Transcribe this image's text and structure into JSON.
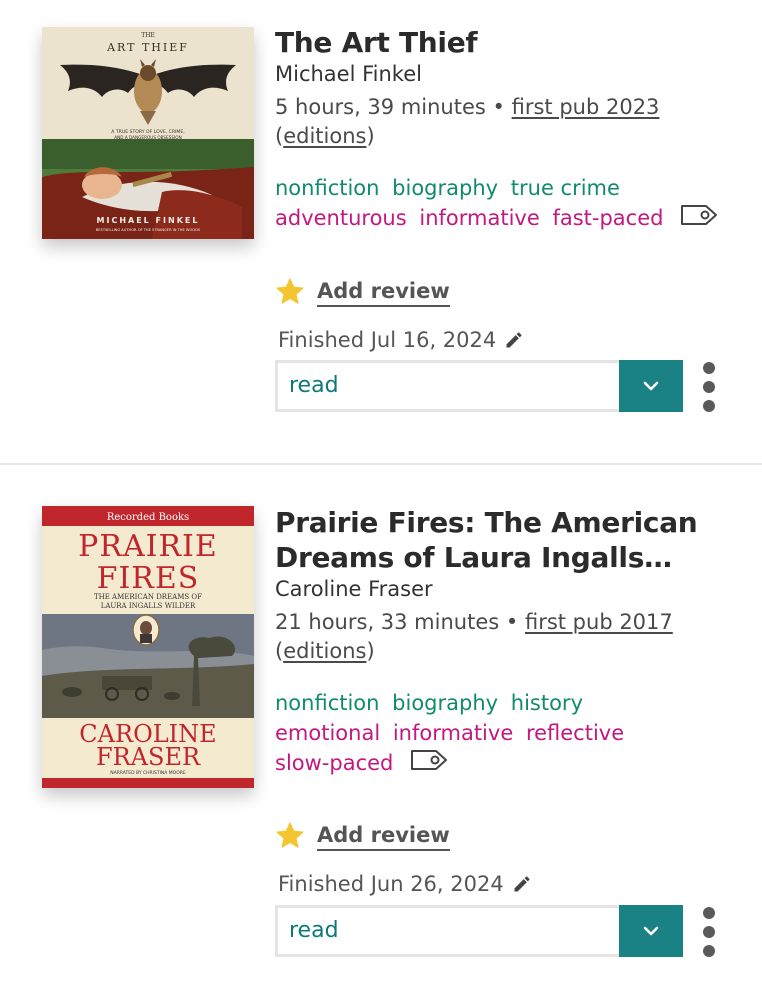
{
  "books": [
    {
      "title": "The Art Thief",
      "author": "Michael Finkel",
      "duration": "5 hours, 39 minutes",
      "separator": "•",
      "first_pub": "first pub 2023",
      "editions": "editions",
      "genre_tags": [
        "nonfiction",
        "biography",
        "true crime"
      ],
      "mood_tags": [
        "adventurous",
        "informative",
        "fast-paced"
      ],
      "add_review": "Add review",
      "finished": "Finished Jul 16, 2024",
      "status": "read",
      "cover": {
        "top_text": "THE",
        "title": "ART THIEF",
        "subtitle_1": "A TRUE STORY OF LOVE, CRIME,",
        "subtitle_2": "AND A DANGEROUS OBSESSION",
        "author": "MICHAEL FINKEL",
        "tagline": "BESTSELLING AUTHOR OF THE STRANGER IN THE WOODS"
      }
    },
    {
      "title": "Prairie Fires: The American Dreams of Laura Ingalls Wilder",
      "author": "Caroline Fraser",
      "duration": "21 hours, 33 minutes",
      "separator": "•",
      "first_pub": "first pub 2017",
      "editions": "editions",
      "genre_tags": [
        "nonfiction",
        "biography",
        "history"
      ],
      "mood_tags": [
        "emotional",
        "informative",
        "reflective",
        "slow-paced"
      ],
      "add_review": "Add review",
      "finished": "Finished Jun 26, 2024",
      "status": "read",
      "cover": {
        "publisher": "Recorded Books",
        "title_1": "PRAIRIE",
        "title_2": "FIRES",
        "subtitle_1": "THE AMERICAN DREAMS OF",
        "subtitle_2": "LAURA INGALLS WILDER",
        "author_1": "CAROLINE",
        "author_2": "FRASER",
        "narrator": "NARRATED BY CHRISTINA MOORE"
      }
    }
  ],
  "colors": {
    "genre_tag": "#118a70",
    "mood_tag": "#c2187f",
    "status_text": "#0d7a78",
    "dropdown_button": "#1a8284",
    "star": "#f2c531"
  },
  "icons": {
    "tag": "tag-icon",
    "star": "star-icon",
    "edit": "pencil-icon",
    "dropdown": "chevron-down-icon",
    "more": "more-vertical-icon"
  }
}
